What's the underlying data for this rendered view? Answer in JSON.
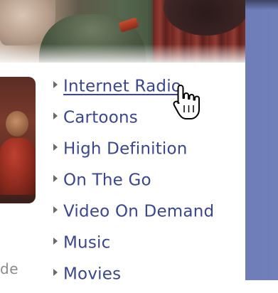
{
  "menu": {
    "items": [
      {
        "label": "Internet Radio"
      },
      {
        "label": "Cartoons"
      },
      {
        "label": "High Definition"
      },
      {
        "label": "On The Go"
      },
      {
        "label": "Video On Demand"
      },
      {
        "label": "Music"
      },
      {
        "label": "Movies"
      }
    ]
  },
  "left_partial_text": "de",
  "colors": {
    "link": "#3a4690",
    "side_strip": "#6e7db7",
    "arrow": "#6a6a6a"
  },
  "icons": {
    "bullet": "triangle-right-icon",
    "cursor": "hand-pointer-icon"
  }
}
